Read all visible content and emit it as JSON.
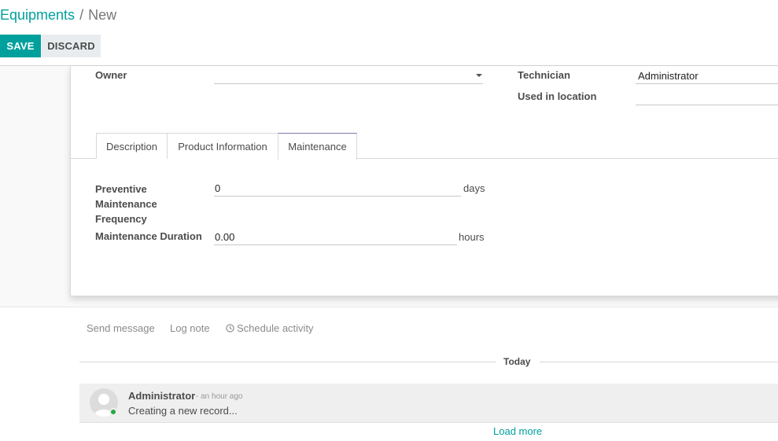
{
  "breadcrumb": {
    "parent": "Equipments",
    "separator": "/",
    "current": "New"
  },
  "toolbar": {
    "save_label": "SAVE",
    "discard_label": "DISCARD"
  },
  "form": {
    "owner_label": "Owner",
    "owner_value": "",
    "technician_label": "Technician",
    "technician_value": "Administrator",
    "used_in_location_label": "Used in location",
    "used_in_location_value": ""
  },
  "tabs": [
    {
      "label": "Description",
      "active": false
    },
    {
      "label": "Product Information",
      "active": false
    },
    {
      "label": "Maintenance",
      "active": true
    }
  ],
  "maintenance": {
    "frequency_label_line1": "Preventive",
    "frequency_label_line2": "Maintenance",
    "frequency_label_line3": "Frequency",
    "frequency_value": "0",
    "frequency_unit": "days",
    "duration_label": "Maintenance Duration",
    "duration_value": "0.00",
    "duration_unit": "hours"
  },
  "chatter": {
    "send_message": "Send message",
    "log_note": "Log note",
    "schedule_activity": "Schedule activity",
    "date_separator": "Today",
    "messages": [
      {
        "author": "Administrator",
        "time": "- an hour ago",
        "body": "Creating a new record..."
      }
    ],
    "load_more": "Load more"
  },
  "colors": {
    "accent": "#00a09d",
    "active_tab_border": "#7c7bad",
    "presence": "#28a745"
  }
}
